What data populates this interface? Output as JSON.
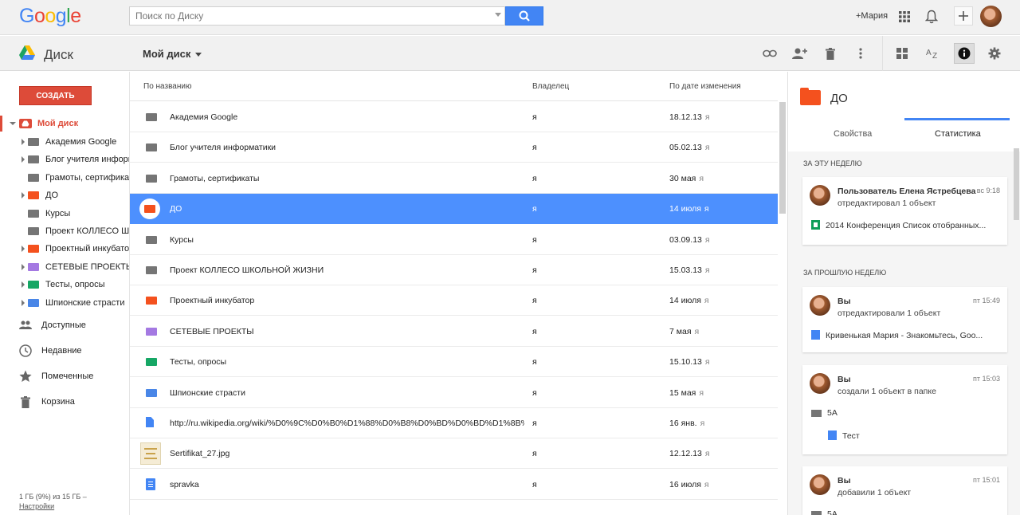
{
  "search": {
    "placeholder": "Поиск по Диску"
  },
  "topbar": {
    "user": "+Мария"
  },
  "app": {
    "name": "Диск"
  },
  "breadcrumb": {
    "current": "Мой диск"
  },
  "leftnav": {
    "create_label": "СОЗДАТЬ",
    "my_drive": "Мой диск",
    "tree": [
      {
        "label": "Академия Google",
        "color": "#757575",
        "expandable": true
      },
      {
        "label": "Блог учителя информатики",
        "color": "#757575",
        "expandable": true
      },
      {
        "label": "Грамоты, сертификаты",
        "color": "#757575",
        "expandable": false
      },
      {
        "label": "ДО",
        "color": "#f4511e",
        "expandable": true
      },
      {
        "label": "Курсы",
        "color": "#757575",
        "expandable": false
      },
      {
        "label": "Проект КОЛЛЕСО ШКОЛЬНОЙ ЖИЗНИ",
        "color": "#757575",
        "expandable": false
      },
      {
        "label": "Проектный инкубатор",
        "color": "#f4511e",
        "expandable": true
      },
      {
        "label": "СЕТЕВЫЕ ПРОЕКТЫ",
        "color": "#a479e2",
        "expandable": true
      },
      {
        "label": "Тесты, опросы",
        "color": "#16a765",
        "expandable": true
      },
      {
        "label": "Шпионские страсти",
        "color": "#4986e7",
        "expandable": true
      }
    ],
    "items": [
      {
        "label": "Доступные",
        "icon": "people-icon"
      },
      {
        "label": "Недавние",
        "icon": "clock-icon"
      },
      {
        "label": "Помеченные",
        "icon": "star-icon"
      },
      {
        "label": "Корзина",
        "icon": "trash-icon"
      }
    ],
    "quota_text": "1 ГБ (9%) из 15 ГБ –",
    "settings_link": "Настройки"
  },
  "list": {
    "headers": {
      "name": "По названию",
      "owner": "Владелец",
      "date": "По дате изменения"
    },
    "rows": [
      {
        "name": "Академия Google",
        "owner": "я",
        "date": "18.12.13",
        "by": "я",
        "type": "folder",
        "color": "#757575"
      },
      {
        "name": "Блог учителя информатики",
        "owner": "я",
        "date": "05.02.13",
        "by": "я",
        "type": "folder",
        "color": "#757575"
      },
      {
        "name": "Грамоты, сертификаты",
        "owner": "я",
        "date": "30 мая",
        "by": "я",
        "type": "folder",
        "color": "#757575"
      },
      {
        "name": "ДО",
        "owner": "я",
        "date": "14 июля",
        "by": "я",
        "type": "folder",
        "color": "#f4511e",
        "selected": true
      },
      {
        "name": "Курсы",
        "owner": "я",
        "date": "03.09.13",
        "by": "я",
        "type": "folder",
        "color": "#757575"
      },
      {
        "name": "Проект КОЛЛЕСО ШКОЛЬНОЙ ЖИЗНИ",
        "owner": "я",
        "date": "15.03.13",
        "by": "я",
        "type": "folder",
        "color": "#757575"
      },
      {
        "name": "Проектный инкубатор",
        "owner": "я",
        "date": "14 июля",
        "by": "я",
        "type": "folder",
        "color": "#f4511e"
      },
      {
        "name": "СЕТЕВЫЕ ПРОЕКТЫ",
        "owner": "я",
        "date": "7 мая",
        "by": "я",
        "type": "folder",
        "color": "#a479e2"
      },
      {
        "name": "Тесты, опросы",
        "owner": "я",
        "date": "15.10.13",
        "by": "я",
        "type": "folder",
        "color": "#16a765"
      },
      {
        "name": "Шпионские страсти",
        "owner": "я",
        "date": "15 мая",
        "by": "я",
        "type": "folder",
        "color": "#4986e7"
      },
      {
        "name": "http://ru.wikipedia.org/wiki/%D0%9C%D0%B0%D1%88%D0%B8%D0%BD%D0%BD%D1%8B%D0...",
        "owner": "я",
        "date": "16 янв.",
        "by": "я",
        "type": "link",
        "color": "#4285f4"
      },
      {
        "name": "Sertifikat_27.jpg",
        "owner": "я",
        "date": "12.12.13",
        "by": "я",
        "type": "image",
        "color": "#c9a24a"
      },
      {
        "name": "spravka",
        "owner": "я",
        "date": "16 июля",
        "by": "я",
        "type": "doc",
        "color": "#4285f4"
      }
    ]
  },
  "details": {
    "title": "ДО",
    "tabs": {
      "props": "Свойства",
      "stats": "Статистика"
    },
    "this_week": "За эту неделю",
    "last_week": "За прошлую неделю",
    "cards": [
      {
        "who": "Пользователь Елена Ястребцева",
        "action": "отредактировал 1 объект",
        "time": "вс 9:18",
        "items": [
          {
            "label": "2014 Конференция Список отобранных...",
            "type": "sheet"
          }
        ]
      },
      {
        "who": "Вы",
        "action": "отредактировали 1 объект",
        "time": "пт 15:49",
        "items": [
          {
            "label": "Кривенькая Мария - Знакомьтесь, Goo...",
            "type": "doc"
          }
        ]
      },
      {
        "who": "Вы",
        "action": "создали 1 объект в папке",
        "time": "пт 15:03",
        "items": [
          {
            "label": "5А",
            "type": "folder"
          },
          {
            "label": "Тест",
            "type": "doc"
          }
        ]
      },
      {
        "who": "Вы",
        "action": "добавили 1 объект",
        "time": "пт 15:01",
        "items": [
          {
            "label": "5А",
            "type": "folder"
          }
        ]
      }
    ]
  },
  "colors": {
    "accent": "#4d90fe",
    "create": "#dd4b39",
    "search_button": "#4285f4"
  }
}
